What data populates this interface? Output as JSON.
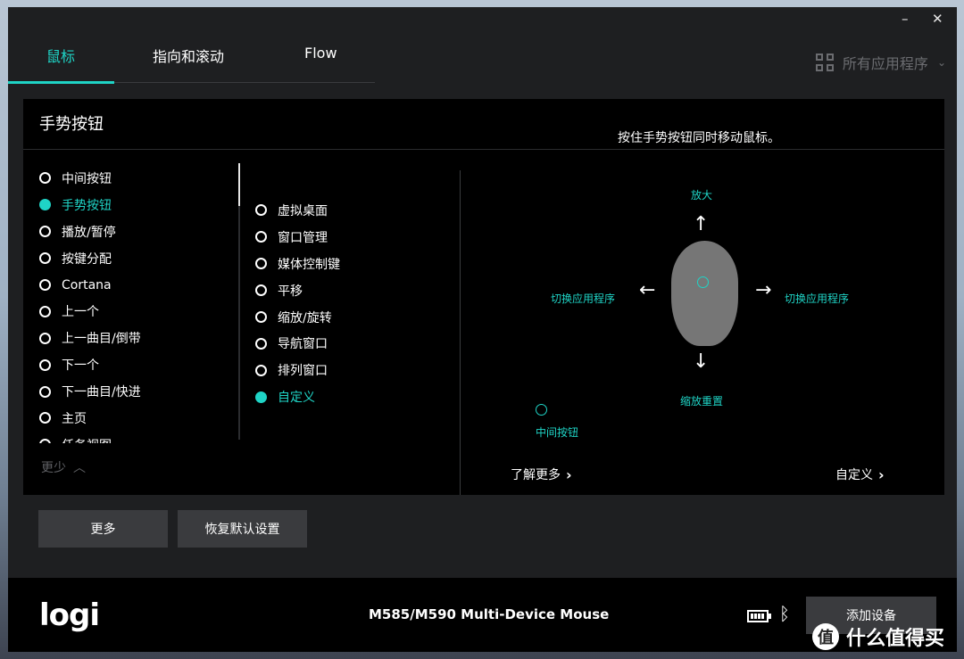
{
  "titlebar": {
    "minimize_glyph": "–",
    "close_glyph": "✕"
  },
  "tabs": [
    {
      "label": "鼠标",
      "active": true
    },
    {
      "label": "指向和滚动",
      "active": false
    },
    {
      "label": "Flow",
      "active": false
    }
  ],
  "app_selector": {
    "label": "所有应用程序",
    "icon": "grid-icon"
  },
  "panel": {
    "title": "手势按钮",
    "hint": "按住手势按钮同时移动鼠标。",
    "button_options": [
      {
        "label": "中间按钮",
        "selected": false
      },
      {
        "label": "手势按钮",
        "selected": true
      },
      {
        "label": "播放/暂停",
        "selected": false
      },
      {
        "label": "按键分配",
        "selected": false
      },
      {
        "label": "Cortana",
        "selected": false
      },
      {
        "label": "上一个",
        "selected": false
      },
      {
        "label": "上一曲目/倒带",
        "selected": false
      },
      {
        "label": "下一个",
        "selected": false
      },
      {
        "label": "下一曲目/快进",
        "selected": false
      },
      {
        "label": "主页",
        "selected": false
      },
      {
        "label": "任务视图",
        "selected": false
      }
    ],
    "gesture_options": [
      {
        "label": "虚拟桌面",
        "selected": false
      },
      {
        "label": "窗口管理",
        "selected": false
      },
      {
        "label": "媒体控制键",
        "selected": false
      },
      {
        "label": "平移",
        "selected": false
      },
      {
        "label": "缩放/旋转",
        "selected": false
      },
      {
        "label": "导航窗口",
        "selected": false
      },
      {
        "label": "排列窗口",
        "selected": false
      },
      {
        "label": "自定义",
        "selected": true
      }
    ],
    "less_label": "更少",
    "gesture_map": {
      "up": "放大",
      "left": "切换应用程序",
      "right": "切换应用程序",
      "down": "缩放重置",
      "middle": "中间按钮"
    },
    "learn_more": "了解更多",
    "customize": "自定义"
  },
  "buttons": {
    "more": "更多",
    "restore": "恢复默认设置"
  },
  "footer": {
    "logo": "logi",
    "device_name": "M585/M590 Multi-Device Mouse",
    "add_device": "添加设备"
  },
  "watermark": {
    "glyph": "值",
    "text": "什么值得买"
  },
  "colors": {
    "accent": "#1fd4c6",
    "panel": "#000000",
    "window": "#1e1f21"
  }
}
